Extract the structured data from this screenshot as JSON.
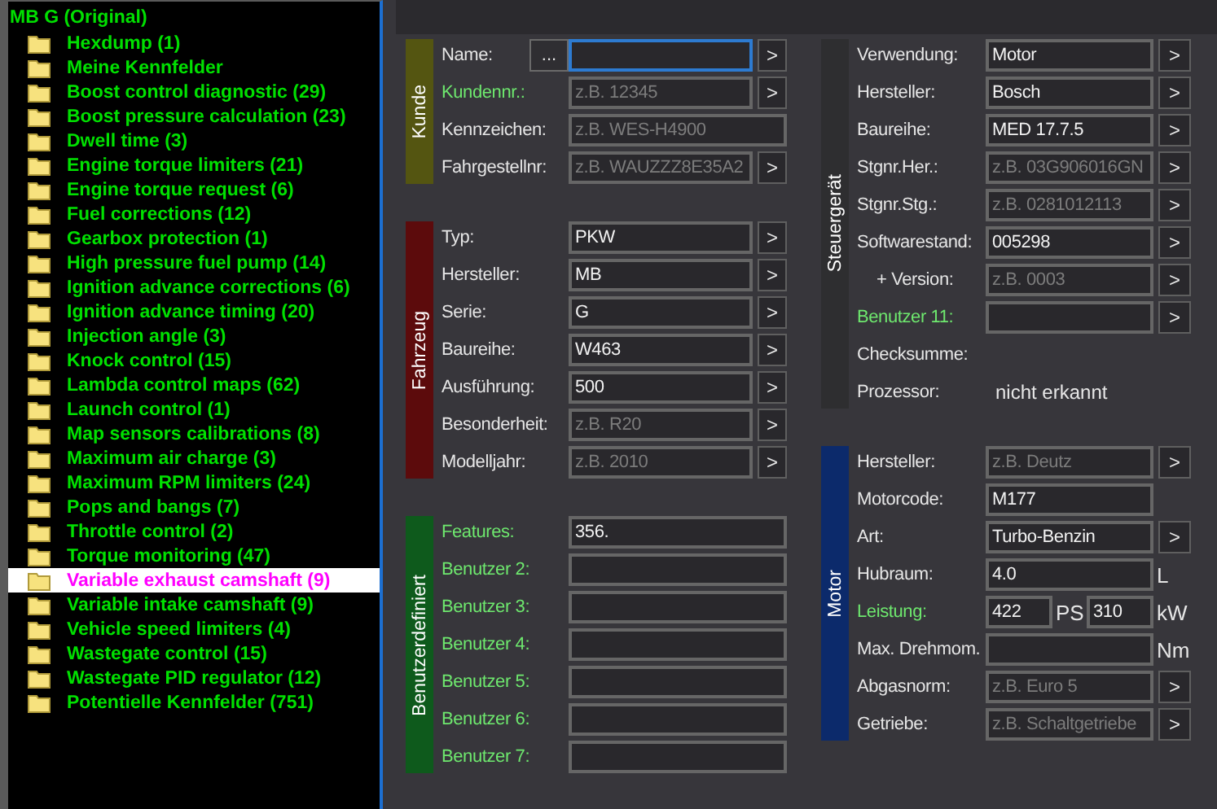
{
  "tree": {
    "root": "MB G (Original)",
    "items": [
      {
        "label": "Hexdump (1)",
        "selected": false
      },
      {
        "label": "Meine Kennfelder",
        "selected": false
      },
      {
        "label": "Boost control diagnostic (29)",
        "selected": false
      },
      {
        "label": "Boost pressure calculation (23)",
        "selected": false
      },
      {
        "label": "Dwell time (3)",
        "selected": false
      },
      {
        "label": "Engine torque limiters (21)",
        "selected": false
      },
      {
        "label": "Engine torque request (6)",
        "selected": false
      },
      {
        "label": "Fuel corrections (12)",
        "selected": false
      },
      {
        "label": "Gearbox protection (1)",
        "selected": false
      },
      {
        "label": "High pressure fuel pump (14)",
        "selected": false
      },
      {
        "label": "Ignition advance corrections (6)",
        "selected": false
      },
      {
        "label": "Ignition advance timing (20)",
        "selected": false
      },
      {
        "label": "Injection angle (3)",
        "selected": false
      },
      {
        "label": "Knock control (15)",
        "selected": false
      },
      {
        "label": "Lambda control maps (62)",
        "selected": false
      },
      {
        "label": "Launch control (1)",
        "selected": false
      },
      {
        "label": "Map sensors calibrations (8)",
        "selected": false
      },
      {
        "label": "Maximum air charge (3)",
        "selected": false
      },
      {
        "label": "Maximum RPM limiters (24)",
        "selected": false
      },
      {
        "label": "Pops and bangs (7)",
        "selected": false
      },
      {
        "label": "Throttle control (2)",
        "selected": false
      },
      {
        "label": "Torque monitoring (47)",
        "selected": false
      },
      {
        "label": "Variable exhaust camshaft (9)",
        "selected": true
      },
      {
        "label": "Variable intake camshaft (9)",
        "selected": false
      },
      {
        "label": "Vehicle speed limiters (4)",
        "selected": false
      },
      {
        "label": "Wastegate control (15)",
        "selected": false
      },
      {
        "label": "Wastegate PID regulator (12)",
        "selected": false
      },
      {
        "label": "Potentielle Kennfelder (751)",
        "selected": false
      }
    ]
  },
  "columns": [
    {
      "groups": [
        {
          "title": "Kunde",
          "color": "#545511",
          "rows": [
            {
              "kind": "select",
              "label": "Name:",
              "highlight": false,
              "more_button": "...",
              "focused": true,
              "arrow": ">"
            },
            {
              "kind": "select",
              "label": "Kundennr.:",
              "highlight": true,
              "inputs": [
                {
                  "placeholder": "z.B. 12345"
                }
              ],
              "arrow": ">"
            },
            {
              "kind": "wide",
              "label": "Kennzeichen:",
              "highlight": false,
              "inputs": [
                {
                  "placeholder": "z.B. WES-H4900"
                }
              ]
            },
            {
              "kind": "select",
              "label": "Fahrgestellnr:",
              "highlight": false,
              "inputs": [
                {
                  "placeholder": "z.B. WAUZZZ8E35A2"
                }
              ],
              "arrow": ">"
            }
          ]
        },
        {
          "title": "Fahrzeug",
          "color": "#5c0b0c",
          "rows": [
            {
              "kind": "select",
              "label": "Typ:",
              "highlight": false,
              "inputs": [
                {
                  "value": "PKW"
                }
              ],
              "arrow": ">"
            },
            {
              "kind": "select",
              "label": "Hersteller:",
              "highlight": false,
              "inputs": [
                {
                  "value": "MB"
                }
              ],
              "arrow": ">"
            },
            {
              "kind": "select",
              "label": "Serie:",
              "highlight": false,
              "inputs": [
                {
                  "value": "G"
                }
              ],
              "arrow": ">"
            },
            {
              "kind": "select",
              "label": "Baureihe:",
              "highlight": false,
              "inputs": [
                {
                  "value": "W463"
                }
              ],
              "arrow": ">"
            },
            {
              "kind": "select",
              "label": "Ausführung:",
              "highlight": false,
              "inputs": [
                {
                  "value": "500"
                }
              ],
              "arrow": ">"
            },
            {
              "kind": "select",
              "label": "Besonderheit:",
              "highlight": false,
              "inputs": [
                {
                  "placeholder": "z.B. R20"
                }
              ],
              "arrow": ">"
            },
            {
              "kind": "select",
              "label": "Modelljahr:",
              "highlight": false,
              "inputs": [
                {
                  "placeholder": "z.B. 2010"
                }
              ],
              "arrow": ">"
            }
          ]
        },
        {
          "title": "Benutzerdefiniert",
          "color": "#0e5a1c",
          "rows": [
            {
              "kind": "wide",
              "label": "Features:",
              "highlight": true,
              "inputs": [
                {
                  "value": "356."
                }
              ]
            },
            {
              "kind": "wide",
              "label": "Benutzer 2:",
              "highlight": true
            },
            {
              "kind": "wide",
              "label": "Benutzer 3:",
              "highlight": true
            },
            {
              "kind": "wide",
              "label": "Benutzer 4:",
              "highlight": true
            },
            {
              "kind": "wide",
              "label": "Benutzer 5:",
              "highlight": true
            },
            {
              "kind": "wide",
              "label": "Benutzer 6:",
              "highlight": true
            },
            {
              "kind": "wide",
              "label": "Benutzer 7:",
              "highlight": true
            }
          ]
        }
      ]
    },
    {
      "groups": [
        {
          "title": "Steuergerät",
          "color": "#2e2e30",
          "rows": [
            {
              "kind": "select",
              "label": "Verwendung:",
              "highlight": false,
              "inputs": [
                {
                  "value": "Motor"
                }
              ],
              "arrow": ">"
            },
            {
              "kind": "select",
              "label": "Hersteller:",
              "highlight": false,
              "inputs": [
                {
                  "value": "Bosch"
                }
              ],
              "arrow": ">"
            },
            {
              "kind": "select",
              "label": "Baureihe:",
              "highlight": false,
              "inputs": [
                {
                  "value": "MED 17.7.5"
                }
              ],
              "arrow": ">"
            },
            {
              "kind": "select",
              "label": "Stgnr.Her.:",
              "highlight": false,
              "inputs": [
                {
                  "placeholder": "z.B. 03G906016GN"
                }
              ],
              "arrow": ">"
            },
            {
              "kind": "select",
              "label": "Stgnr.Stg.:",
              "highlight": false,
              "inputs": [
                {
                  "placeholder": "z.B. 0281012113"
                }
              ],
              "arrow": ">"
            },
            {
              "kind": "select",
              "label": "Softwarestand:",
              "highlight": false,
              "inputs": [
                {
                  "value": "005298"
                }
              ],
              "arrow": ">"
            },
            {
              "kind": "select",
              "label": "+ Version:",
              "highlight": false,
              "indent": true,
              "inputs": [
                {
                  "placeholder": "z.B. 0003"
                }
              ],
              "arrow": ">"
            },
            {
              "kind": "select",
              "label": "Benutzer 11:",
              "highlight": true,
              "arrow": ">"
            },
            {
              "kind": "info",
              "label": "Checksumme:",
              "highlight": false
            },
            {
              "kind": "info",
              "label": "Prozessor:",
              "highlight": false,
              "text": "nicht erkannt"
            }
          ]
        },
        {
          "title": "Motor",
          "color": "#0c2a6b",
          "rows": [
            {
              "kind": "select",
              "label": "Hersteller:",
              "highlight": false,
              "inputs": [
                {
                  "placeholder": "z.B. Deutz"
                }
              ],
              "arrow": ">"
            },
            {
              "kind": "plain",
              "label": "Motorcode:",
              "highlight": false,
              "inputs": [
                {
                  "value": "M177"
                }
              ]
            },
            {
              "kind": "select",
              "label": "Art:",
              "highlight": false,
              "inputs": [
                {
                  "value": "Turbo-Benzin"
                }
              ],
              "arrow": ">"
            },
            {
              "kind": "unit",
              "label": "Hubraum:",
              "highlight": false,
              "inputs": [
                {
                  "value": "4.0",
                  "unit": "L"
                }
              ]
            },
            {
              "kind": "pair",
              "label": "Leistung:",
              "highlight": true,
              "inputs": [
                {
                  "value": "422",
                  "unit": "PS"
                },
                {
                  "value": "310",
                  "unit": "kW"
                }
              ]
            },
            {
              "kind": "unit",
              "label": "Max. Drehmom.",
              "highlight": false,
              "inputs": [
                {
                  "unit": "Nm"
                }
              ]
            },
            {
              "kind": "select",
              "label": "Abgasnorm:",
              "highlight": false,
              "inputs": [
                {
                  "placeholder": "z.B. Euro 5"
                }
              ],
              "arrow": ">"
            },
            {
              "kind": "select",
              "label": "Getriebe:",
              "highlight": false,
              "inputs": [
                {
                  "placeholder": "z.B. Schaltgetriebe"
                }
              ],
              "arrow": ">"
            }
          ]
        }
      ]
    }
  ]
}
